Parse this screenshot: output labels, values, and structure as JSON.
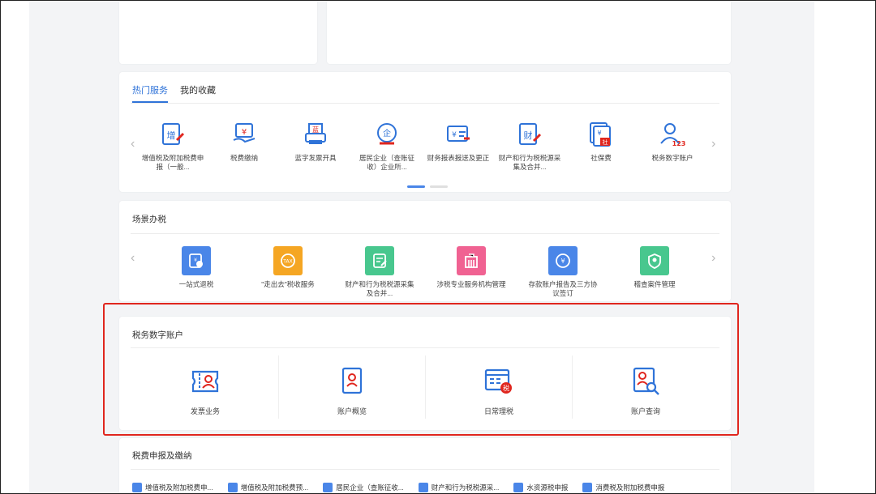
{
  "tabs": {
    "hot": "热门服务",
    "fav": "我的收藏"
  },
  "hot_services": [
    {
      "label": "增值税及附加税费申报（一般...",
      "icon": "vat-declare-icon"
    },
    {
      "label": "税费缴纳",
      "icon": "tax-payment-icon"
    },
    {
      "label": "蓝字发票开具",
      "icon": "invoice-print-icon"
    },
    {
      "label": "居民企业（查账征收）企业所...",
      "icon": "enterprise-tax-icon"
    },
    {
      "label": "财务报表报送及更正",
      "icon": "financial-report-icon"
    },
    {
      "label": "财产和行为税税源采集及合并...",
      "icon": "property-tax-icon"
    },
    {
      "label": "社保费",
      "icon": "social-insurance-icon"
    },
    {
      "label": "税务数字账户",
      "icon": "digital-account-icon"
    }
  ],
  "scene": {
    "title": "场景办税",
    "items": [
      {
        "label": "一站式退税",
        "color": "#4a86e8",
        "icon": "refund-icon"
      },
      {
        "label": "\"走出去\"税收服务",
        "color": "#f5a623",
        "icon": "tax-globe-icon"
      },
      {
        "label": "财产和行为税税源采集及合并...",
        "color": "#48c78e",
        "icon": "property-form-icon"
      },
      {
        "label": "涉税专业服务机构管理",
        "color": "#f06292",
        "icon": "building-icon"
      },
      {
        "label": "存款账户报告及三方协议签订",
        "color": "#4a86e8",
        "icon": "bank-account-icon"
      },
      {
        "label": "稽查案件管理",
        "color": "#48c78e",
        "icon": "case-shield-icon"
      }
    ]
  },
  "digital_account": {
    "title": "税务数字账户",
    "items": [
      {
        "label": "发票业务",
        "icon": "invoice-ticket-icon"
      },
      {
        "label": "账户概览",
        "icon": "account-book-icon"
      },
      {
        "label": "日常理税",
        "icon": "daily-tax-icon"
      },
      {
        "label": "账户查询",
        "icon": "account-search-icon"
      }
    ]
  },
  "declare": {
    "title": "税费申报及缴纳",
    "items": [
      {
        "label": "增值税及附加税费申..."
      },
      {
        "label": "增值税及附加税费预..."
      },
      {
        "label": "居民企业（查账征收..."
      },
      {
        "label": "财产和行为税税源采..."
      },
      {
        "label": "水资源税申报"
      },
      {
        "label": "消费税及附加税费申报"
      }
    ]
  },
  "colors": {
    "accent": "#2f73d8",
    "highlight": "#e0261e"
  }
}
